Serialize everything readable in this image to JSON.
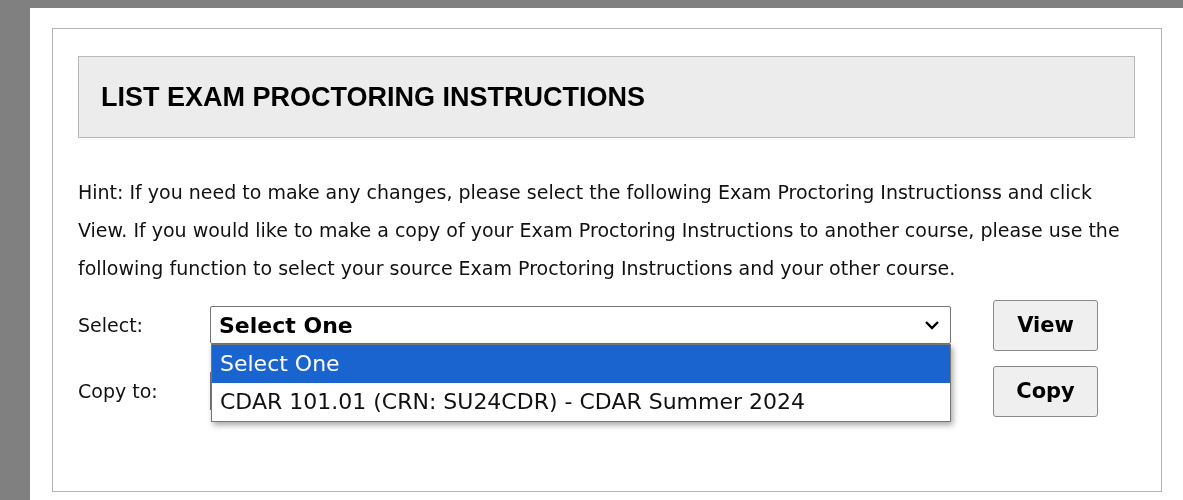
{
  "header": {
    "title": "LIST EXAM PROCTORING INSTRUCTIONS"
  },
  "hint": "Hint: If you need to make any changes, please select the following Exam Proctoring Instructionss and click View. If you would like to make a copy of your Exam Proctoring Instructions to another course, please use the following function to select your source Exam Proctoring Instructions and your other course.",
  "select_row": {
    "label": "Select:",
    "value": "Select One",
    "expanded": true,
    "options": [
      {
        "label": "Select One",
        "selected": true
      },
      {
        "label": "CDAR 101.01 (CRN: SU24CDR) - CDAR Summer 2024",
        "selected": false
      }
    ],
    "button": "View"
  },
  "copy_row": {
    "label": "Copy to:",
    "button": "Copy"
  }
}
